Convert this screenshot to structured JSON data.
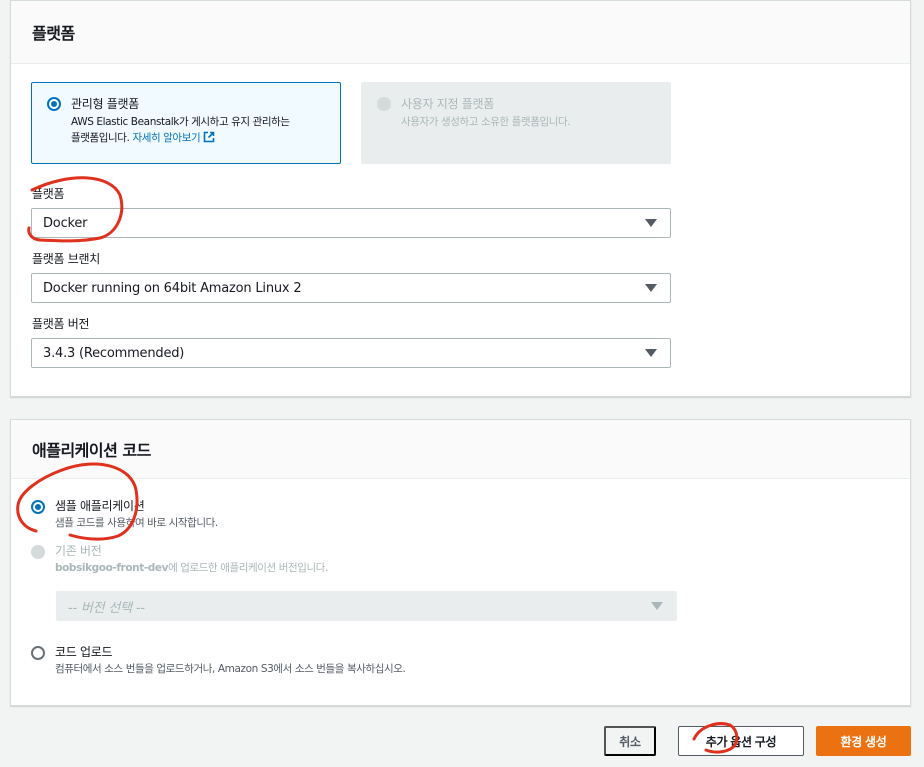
{
  "platform_section": {
    "title": "플랫폼",
    "managed_tile": {
      "title": "관리형 플랫폼",
      "desc_line1": "AWS Elastic Beanstalk가 게시하고 유지 관리하는",
      "desc_line2": "플랫폼입니다.",
      "learn_more": "자세히 알아보기",
      "selected": true
    },
    "custom_tile": {
      "title": "사용자 지정 플랫폼",
      "desc": "사용자가 생성하고 소유한 플랫폼입니다.",
      "disabled": true
    },
    "platform_field": {
      "label": "플랫폼",
      "value": "Docker"
    },
    "branch_field": {
      "label": "플랫폼 브랜치",
      "value": "Docker running on 64bit Amazon Linux 2"
    },
    "version_field": {
      "label": "플랫폼 버전",
      "value": "3.4.3 (Recommended)"
    }
  },
  "app_code_section": {
    "title": "애플리케이션 코드",
    "sample_option": {
      "title": "샘플 애플리케이션",
      "desc": "샘플 코드를 사용하여 바로 시작합니다.",
      "selected": true
    },
    "existing_option": {
      "title": "기존 버전",
      "desc_bold": "bobsikgoo-front-dev",
      "desc_rest": "에 업로드한 애플리케이션 버전입니다.",
      "disabled": true,
      "select_placeholder": "-- 버전 선택 --"
    },
    "upload_option": {
      "title": "코드 업로드",
      "desc": "컴퓨터에서 소스 번들을 업로드하거나, Amazon S3에서 소스 번들을 복사하십시오."
    }
  },
  "footer": {
    "cancel": "취소",
    "more_options": "추가 옵션 구성",
    "create": "환경 생성"
  },
  "colors": {
    "accent_blue": "#0073bb",
    "primary_orange": "#ec7211",
    "annotation_red": "#e0301e"
  }
}
